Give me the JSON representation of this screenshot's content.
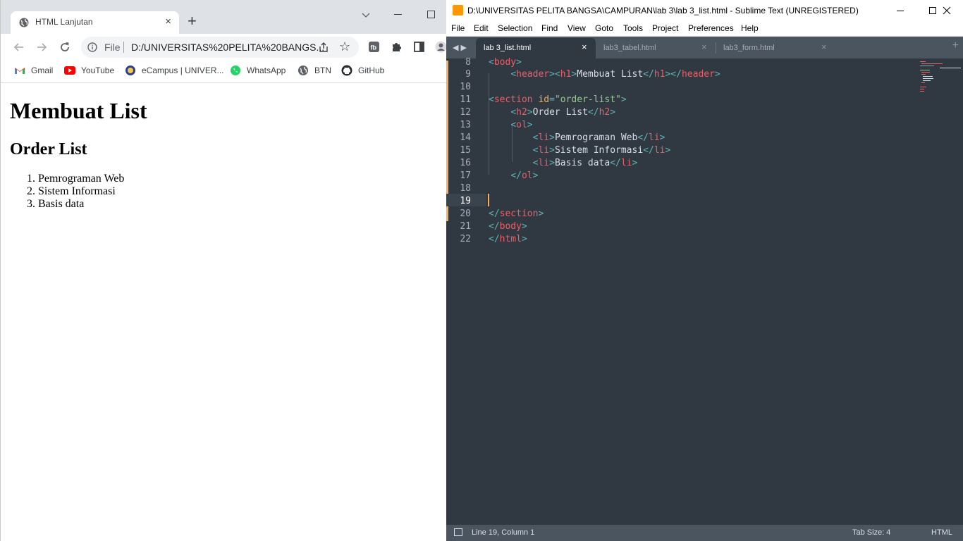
{
  "browser": {
    "tab": {
      "title": "HTML Lanjutan",
      "close": "×"
    },
    "new_tab": "+",
    "address": {
      "scheme_label": "File",
      "url": "D:/UNIVERSITAS%20PELITA%20BANGS..."
    },
    "bookmarks": [
      {
        "label": "Gmail",
        "icon": "gmail-icon"
      },
      {
        "label": "YouTube",
        "icon": "youtube-icon"
      },
      {
        "label": "eCampus | UNIVER...",
        "icon": "ecampus-icon"
      },
      {
        "label": "WhatsApp",
        "icon": "whatsapp-icon"
      },
      {
        "label": "BTN",
        "icon": "globe-icon"
      },
      {
        "label": "GitHub",
        "icon": "github-icon"
      }
    ],
    "page": {
      "h1": "Membuat List",
      "h2": "Order List",
      "items": [
        "Pemrograman Web",
        "Sistem Informasi",
        "Basis data"
      ]
    }
  },
  "editor": {
    "window_title": "D:\\UNIVERSITAS PELITA BANGSA\\CAMPURAN\\lab 3\\lab 3_list.html - Sublime Text (UNREGISTERED)",
    "menu": [
      "File",
      "Edit",
      "Selection",
      "Find",
      "View",
      "Goto",
      "Tools",
      "Project",
      "Preferences",
      "Help"
    ],
    "tabs": [
      {
        "label": "lab 3_list.html",
        "active": true
      },
      {
        "label": "lab3_tabel.html",
        "active": false
      },
      {
        "label": "lab3_form.html",
        "active": false
      }
    ],
    "tab_close": "×",
    "tab_add": "+",
    "tab_arrows": "◀▶",
    "line_numbers": [
      "8",
      "9",
      "10",
      "11",
      "12",
      "13",
      "14",
      "15",
      "16",
      "17",
      "18",
      "19",
      "20",
      "21",
      "22"
    ],
    "current_line": "19",
    "status": {
      "position": "Line 19, Column 1",
      "tab_size": "Tab Size: 4",
      "syntax": "HTML"
    },
    "colors": {
      "tag": "#ec5f66",
      "punct": "#5fb4b4",
      "attr": "#f9ae58",
      "string": "#99c794",
      "text": "#d8dee9",
      "background": "#303841"
    }
  }
}
